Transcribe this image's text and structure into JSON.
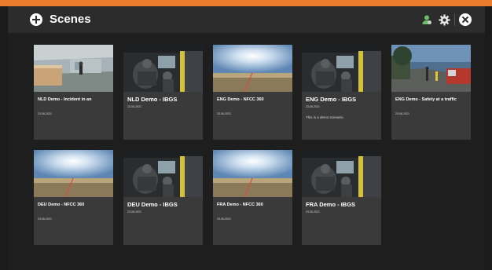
{
  "header": {
    "title": "Scenes",
    "icons": {
      "add": "add-circle-icon",
      "user": "user-icon",
      "settings": "gear-icon",
      "close": "close-icon"
    }
  },
  "colors": {
    "accent": "#ea7a2c",
    "header_bg": "#2c2c2c",
    "card_bg": "#3a3a3a",
    "user_icon": "#6bbf6b"
  },
  "scenes": [
    {
      "title": "NLD Demo - Incident in an",
      "date": "23-06-2021",
      "description": "",
      "thumbnail": "office-room"
    },
    {
      "title": "NLD Demo - IBGS",
      "date": "23-06-2021",
      "description": "",
      "thumbnail": "truck-cabin"
    },
    {
      "title": "ENG Demo - NFCC 360",
      "date": "23-06-2021",
      "description": "",
      "thumbnail": "sky-horizon"
    },
    {
      "title": "ENG Demo - IBGS",
      "date": "23-06-2021",
      "description": "This is a demo scenario.",
      "thumbnail": "truck-cabin"
    },
    {
      "title": "ENG Demo - Safety at a traffic",
      "date": "23-06-2021",
      "description": "",
      "thumbnail": "traffic-street"
    },
    {
      "title": "DEU Demo - NFCC 360",
      "date": "23-06-2021",
      "description": "",
      "thumbnail": "sky-horizon"
    },
    {
      "title": "DEU Demo - IBGS",
      "date": "23-06-2021",
      "description": "",
      "thumbnail": "truck-cabin"
    },
    {
      "title": "FRA Demo - NFCC 360",
      "date": "23-06-2021",
      "description": "",
      "thumbnail": "sky-horizon"
    },
    {
      "title": "FRA Demo - IBGS",
      "date": "23-06-2021",
      "description": "",
      "thumbnail": "truck-cabin"
    }
  ]
}
